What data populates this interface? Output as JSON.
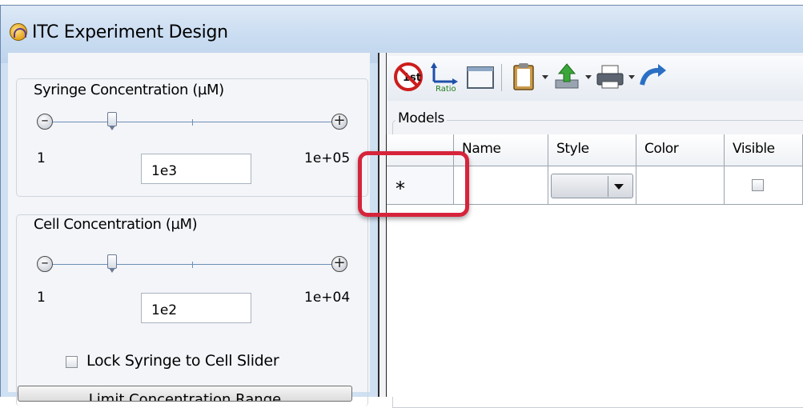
{
  "window": {
    "title": "ITC Experiment Design"
  },
  "syringe": {
    "label": "Syringe Concentration (µM)",
    "min_label": "1",
    "max_label": "1e+05",
    "value": "1e3",
    "slider_position": 0.2
  },
  "cell": {
    "label": "Cell Concentration (µM)",
    "min_label": "1",
    "max_label": "1e+04",
    "value": "1e2",
    "slider_position": 0.2
  },
  "lock": {
    "label": "Lock Syringe to Cell Slider",
    "checked": false
  },
  "bottom_button": {
    "label": "Limit Concentration Range"
  },
  "toolbar": {
    "icons": [
      "no-first-point-icon",
      "ratio-axis-icon",
      "window-icon",
      "clipboard-icon",
      "export-icon",
      "print-icon",
      "refresh-icon"
    ],
    "ratio_text": "Ratio",
    "first_text": "1st"
  },
  "models": {
    "label": "Models",
    "columns": [
      "Name",
      "Style",
      "Color",
      "Visible"
    ],
    "new_row_marker": "*"
  },
  "colors": {
    "highlight": "#d6243b",
    "title_bar": "#cfe0f2"
  }
}
